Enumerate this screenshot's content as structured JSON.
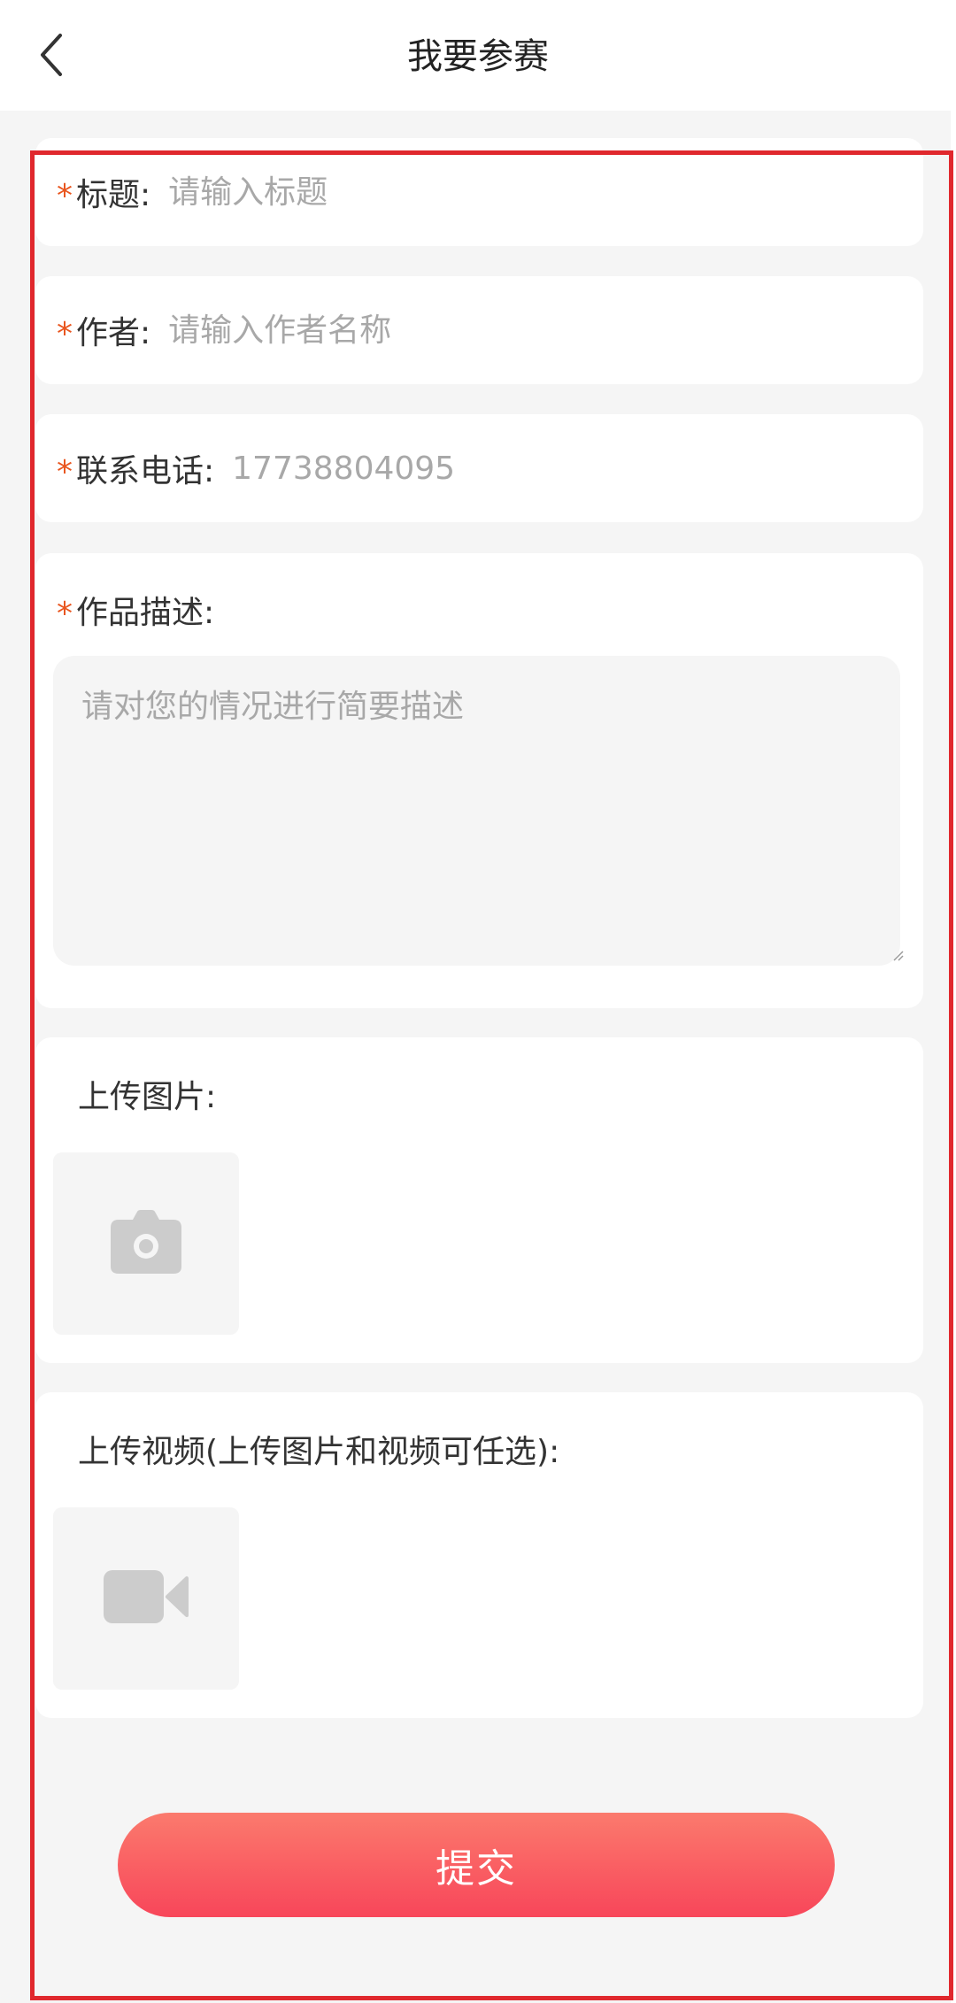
{
  "nav": {
    "title": "我要参赛",
    "back_icon": "chevron-left-icon"
  },
  "form": {
    "required_marker": "*",
    "title_field": {
      "label": "标题:",
      "placeholder": "请输入标题"
    },
    "author_field": {
      "label": "作者:",
      "placeholder": "请输入作者名称"
    },
    "phone_field": {
      "label": "联系电话:",
      "value": "17738804095"
    },
    "description_field": {
      "label": "作品描述:",
      "placeholder": "请对您的情况进行简要描述"
    },
    "image_upload": {
      "label": "上传图片:",
      "icon": "camera-icon"
    },
    "video_upload": {
      "label": "上传视频(上传图片和视频可任选):",
      "icon": "video-camera-icon"
    },
    "submit_label": "提交"
  },
  "colors": {
    "required_star": "#e9561f",
    "placeholder": "#a8a8a8",
    "button_gradient_top": "#fb7a6d",
    "button_gradient_bottom": "#f8465a",
    "highlight_frame": "#e0282d",
    "page_background": "#f5f5f5",
    "upload_icon": "#cccccc"
  }
}
